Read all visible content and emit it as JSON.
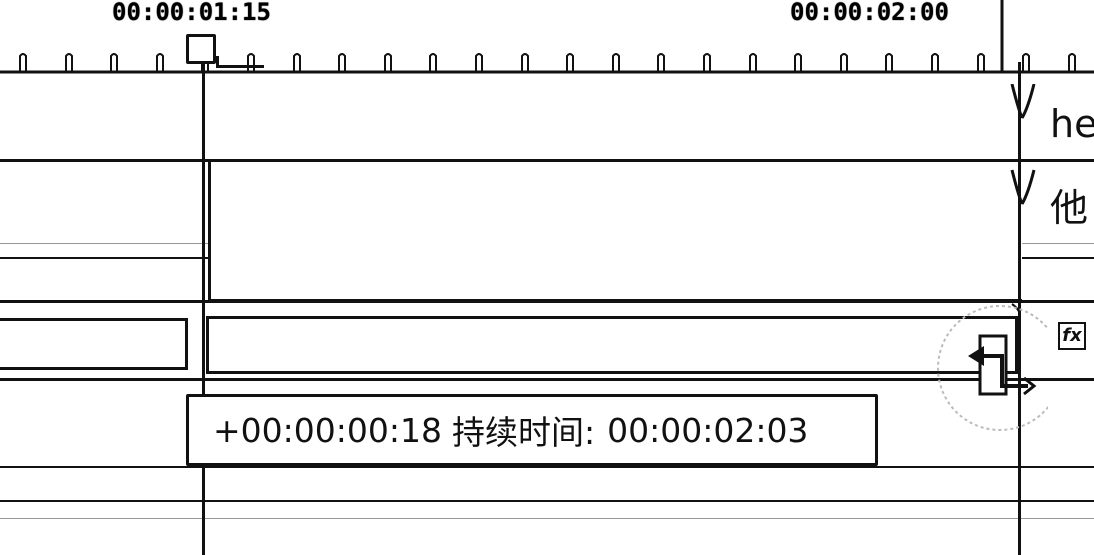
{
  "ruler": {
    "timecode_left": "00:00:01:15",
    "timecode_right": "00:00:02:00"
  },
  "tracks": {
    "clip_1_label": "he",
    "clip_2_label": "他"
  },
  "tooltip": {
    "offset": "+00:00:00:18",
    "duration_label": "持续时间:",
    "duration_value": "00:00:02:03"
  },
  "effects": {
    "fx_label": "fx",
    "icon": "fx-icon"
  },
  "cursor": {
    "icon": "trim-cursor-icon"
  }
}
